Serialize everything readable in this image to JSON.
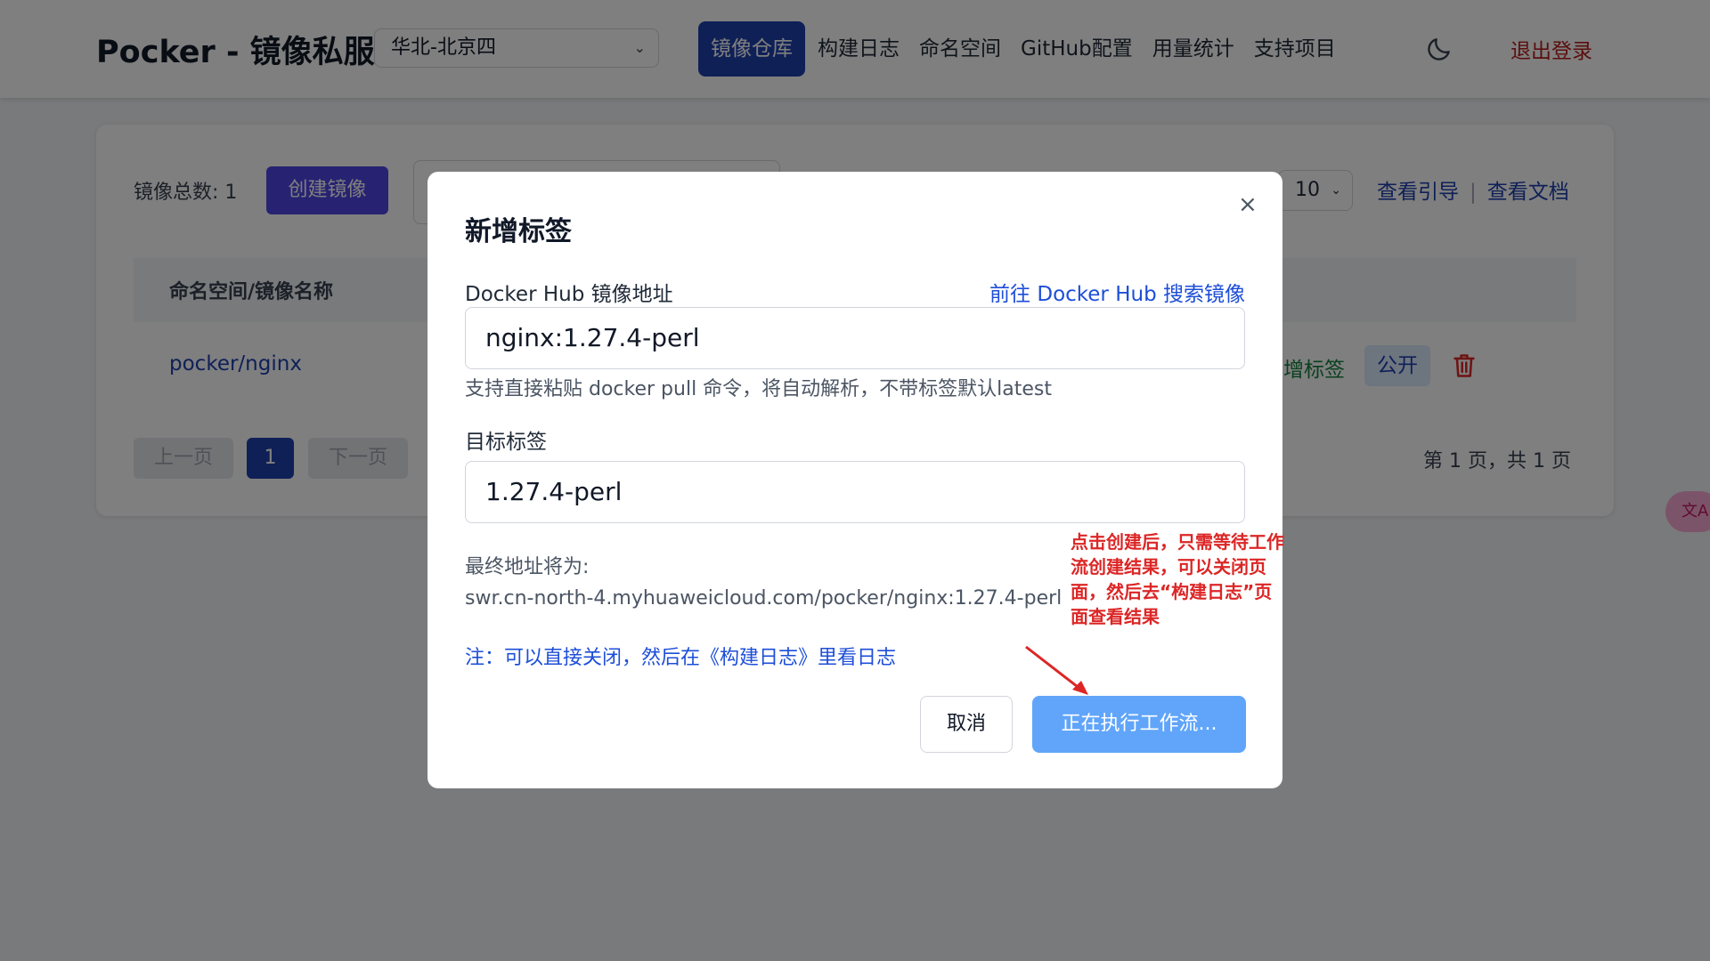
{
  "header": {
    "brand": "Pocker - 镜像私服",
    "region": "华北-北京四",
    "nav": [
      {
        "label": "镜像仓库",
        "active": true
      },
      {
        "label": "构建日志"
      },
      {
        "label": "命名空间"
      },
      {
        "label": "GitHub配置"
      },
      {
        "label": "用量统计"
      },
      {
        "label": "支持项目"
      }
    ],
    "logout": "退出登录"
  },
  "toolbar": {
    "total": "镜像总数: 1",
    "create": "创建镜像",
    "page_size": "10",
    "guide": "查看引导",
    "docs": "查看文档"
  },
  "table": {
    "col_name": "命名空间/镜像名称",
    "rows": [
      {
        "name": "pocker/nginx",
        "add_tag": "新增标签",
        "visibility": "公开"
      }
    ]
  },
  "pagination": {
    "prev": "上一页",
    "current": "1",
    "next": "下一页",
    "info": "第 1 页，共 1 页"
  },
  "translate": "文A",
  "modal": {
    "title": "新增标签",
    "close": "×",
    "src_label": "Docker Hub 镜像地址",
    "hub_link": "前往 Docker Hub 搜索镜像",
    "src_value": "nginx:1.27.4-perl",
    "hint": "支持直接粘贴 docker pull 命令，将自动解析，不带标签默认latest",
    "tag_label": "目标标签",
    "tag_value": "1.27.4-perl",
    "final_label": "最终地址将为:",
    "final_addr": "swr.cn-north-4.myhuaweicloud.com/pocker/nginx:1.27.4-perl",
    "note": "注：可以直接关闭，然后在《构建日志》里看日志",
    "cancel": "取消",
    "running": "正在执行工作流...",
    "annotation": "点击创建后，只需等待工作流创建结果，可以关闭页面，然后去“构建日志”页面查看结果"
  }
}
